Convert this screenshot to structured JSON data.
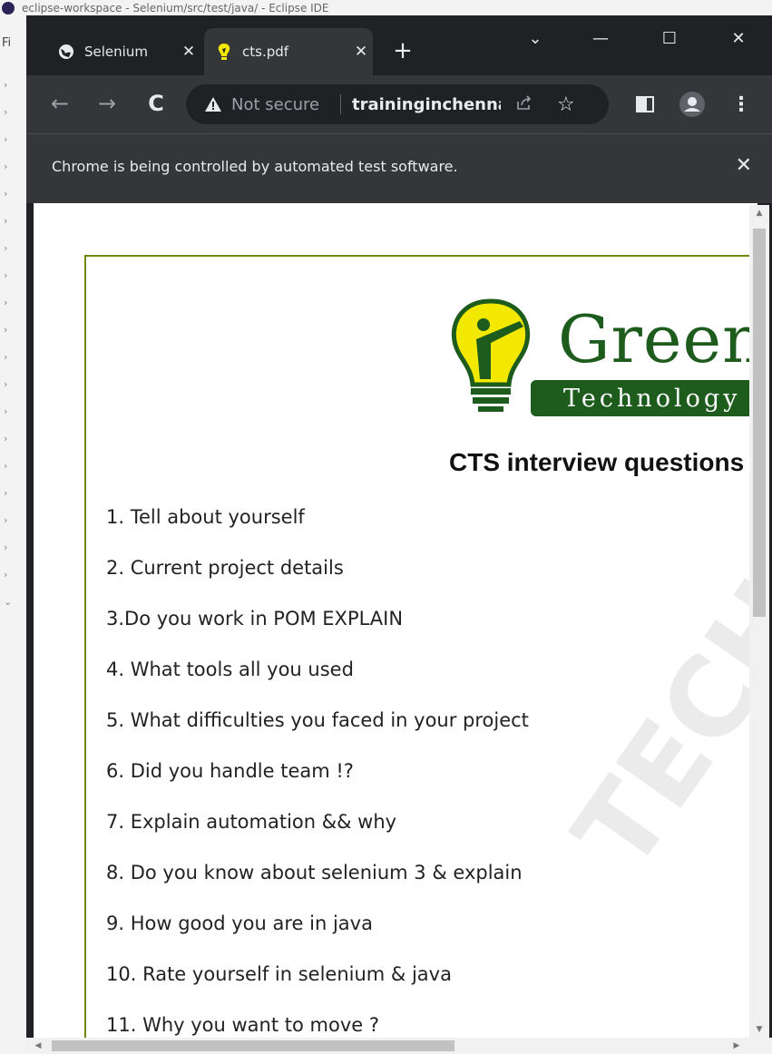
{
  "ide": {
    "title": "eclipse-workspace - Selenium/src/test/java/ - Eclipse IDE",
    "menu_fragment": "Fi"
  },
  "browser": {
    "tabs": [
      {
        "label": "Selenium",
        "icon": "globe-icon",
        "active": false
      },
      {
        "label": "cts.pdf",
        "icon": "greens-favicon-icon",
        "active": true
      }
    ],
    "new_tab": "+",
    "window_controls": {
      "dropdown": "⌄",
      "minimize": "—",
      "maximize": "☐",
      "close": "✕"
    },
    "toolbar": {
      "back": "←",
      "forward": "→",
      "reload": "C",
      "security_label": "Not secure",
      "url": "traininginchennai.co.in",
      "share_icon": "share-icon",
      "star": "☆"
    },
    "infobar": {
      "text": "Chrome is being controlled by automated test software.",
      "close": "✕"
    }
  },
  "pdf": {
    "logo_text": "Greens",
    "logo_subtext": "Technology",
    "title": "CTS interview questions",
    "questions": [
      "1. Tell about yourself",
      "2. Current project details",
      "3.Do you work in POM EXPLAIN",
      "4. What tools all you used",
      "5. What difficulties you faced in your project",
      "6. Did you handle team !?",
      "7. Explain automation && why",
      "8. Do you know about selenium 3 & explain",
      "9. How good you are in java",
      "10. Rate yourself in selenium & java",
      "11. Why you want to move ?"
    ],
    "watermark": "TECHNOLOGY"
  },
  "colors": {
    "chrome_dark": "#202124",
    "chrome_toolbar": "#35363a",
    "border_green": "#6a8a00",
    "logo_green": "#1d5c1d",
    "bulb_yellow": "#f2e800"
  }
}
